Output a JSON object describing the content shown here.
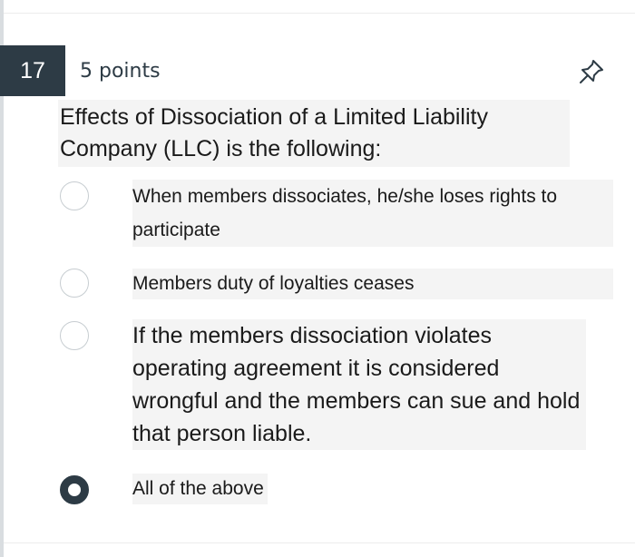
{
  "question": {
    "number": "17",
    "points": "5 points",
    "text": "Effects of Dissociation of a Limited Liability Company (LLC) is the following:",
    "pin_icon": "pin-icon"
  },
  "options": [
    {
      "label": "When members dissociates, he/she loses rights to participate",
      "selected": false
    },
    {
      "label": "Members duty of loyalties ceases",
      "selected": false
    },
    {
      "label": "If the members dissociation violates operating agreement it is considered wrongful and the members can sue and hold that person liable.",
      "selected": false
    },
    {
      "label": "All of the above",
      "selected": true
    }
  ],
  "colors": {
    "number_badge_bg": "#2d3b45",
    "radio_border": "#c7cdd1",
    "radio_selected": "#2d3b45"
  }
}
